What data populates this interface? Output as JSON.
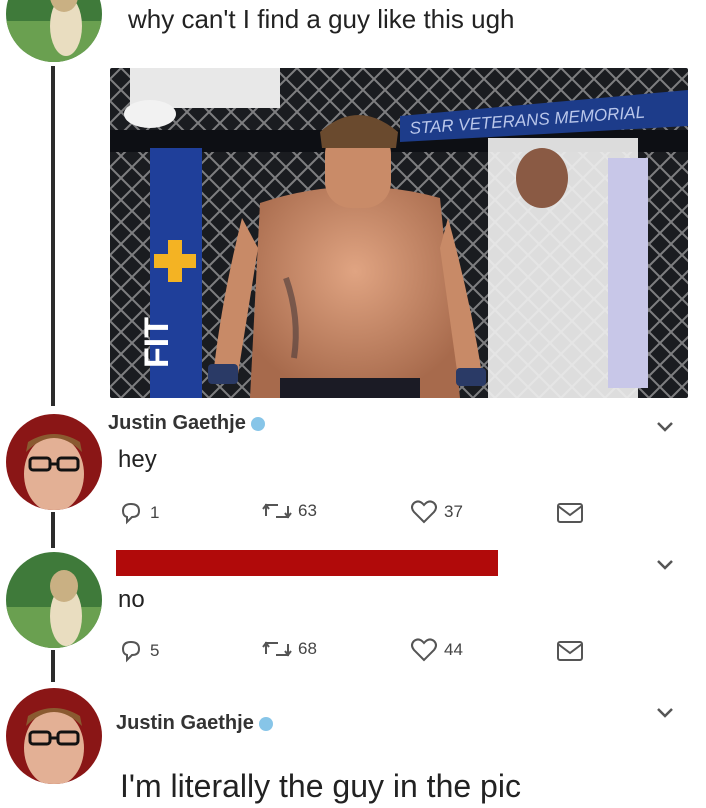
{
  "tweet1": {
    "text": "why can't I find a guy like this ugh"
  },
  "photo": {
    "banner_text": "STAR VETERANS MEMORIAL",
    "side_logo": "FIT"
  },
  "tweet2": {
    "author": "Justin Gaethje",
    "text": "hey",
    "replies": "1",
    "retweets": "63",
    "likes": "37"
  },
  "tweet3": {
    "text": "no",
    "replies": "5",
    "retweets": "68",
    "likes": "44"
  },
  "tweet4": {
    "author": "Justin Gaethje",
    "text": "I'm literally the guy in the pic"
  },
  "colors": {
    "redaction": "#b10a0a",
    "verified": "#87c5e8"
  }
}
